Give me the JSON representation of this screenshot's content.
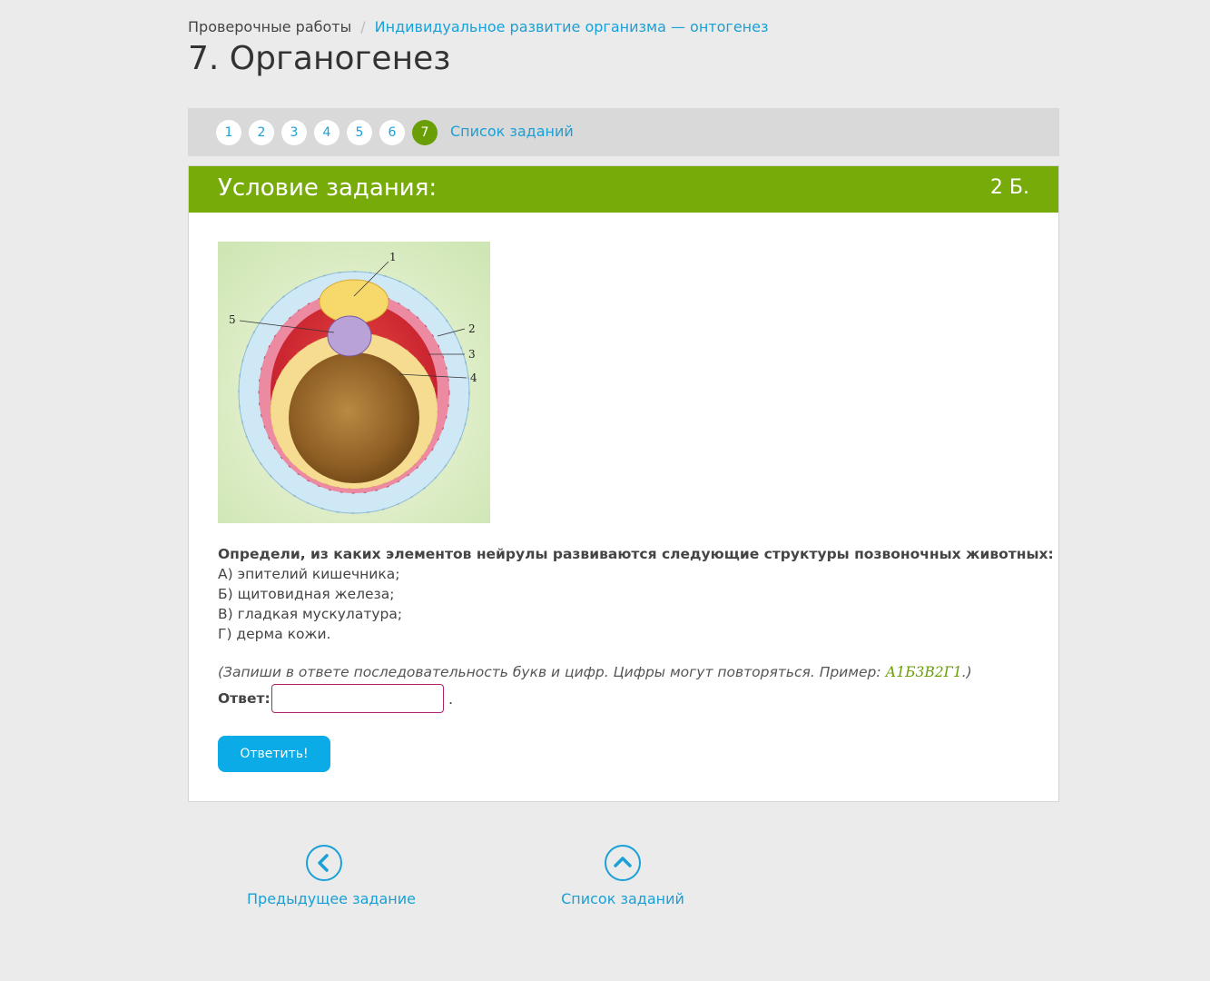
{
  "breadcrumb": {
    "root": "Проверочные работы",
    "separator": "/",
    "current": "Индивидуальное развитие организма — онтогенез"
  },
  "page_title": "7. Органогенез",
  "pager": {
    "items": [
      "1",
      "2",
      "3",
      "4",
      "5",
      "6",
      "7"
    ],
    "active": "7",
    "list_link": "Список заданий"
  },
  "task": {
    "header": "Условие задания:",
    "score": "2 Б.",
    "figure_labels": [
      "1",
      "2",
      "3",
      "4",
      "5"
    ],
    "question": "Определи, из каких элементов нейрулы развиваются следующие структуры позвоночных животных:",
    "options": [
      "А) эпителий кишечника;",
      "Б) щитовидная железа;",
      "В) гладкая мускулатура;",
      "Г) дерма кожи."
    ],
    "hint": "(Запиши в ответе последовательность букв и цифр. Цифры могут повторяться. Пример: ",
    "hint_example": "А1Б3В2Г1",
    "hint_end": ".)",
    "answer_label": "Ответ:",
    "answer_value": "",
    "answer_suffix": ".",
    "submit_label": "Ответить!"
  },
  "bottom_nav": {
    "prev_label": "Предыдущее задание",
    "list_label": "Список заданий"
  },
  "colors": {
    "accent_green": "#77ab0a",
    "active_dot": "#6a9e05",
    "link_blue": "#1aa0d6",
    "button_blue": "#0aabe6",
    "input_border": "#b0226a"
  }
}
